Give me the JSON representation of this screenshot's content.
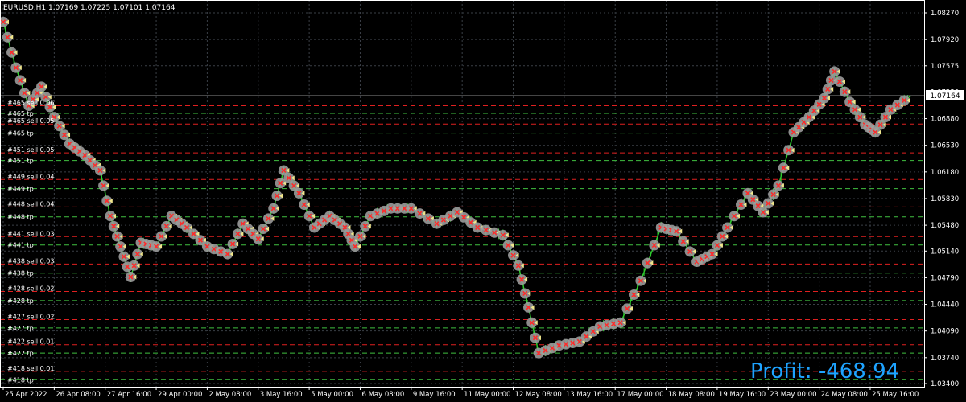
{
  "symbol_header": "EURUSD,H1  1.07169 1.07225 1.07101 1.07164",
  "current_price": "1.07164",
  "profit": {
    "label": "Profit: -468.94",
    "value": -468.94
  },
  "colors": {
    "background": "#000000",
    "grid": "#3a3f46",
    "frame": "#ffffff",
    "candle": "#2ecc2e",
    "sell_line": "#e02020",
    "tp_line": "#40c040",
    "profit_text": "#1ea3ff",
    "marker_circle": "#9a9a9a",
    "marker_cross": "#ff2a2a",
    "marker_arrow": "#f0e68c"
  },
  "chart_data": {
    "type": "line",
    "title": "EURUSD,H1",
    "y_ticks": [
      "1.08270",
      "1.07920",
      "1.07575",
      "1.07230",
      "1.06880",
      "1.06530",
      "1.06180",
      "1.05830",
      "1.05480",
      "1.05140",
      "1.04790",
      "1.04440",
      "1.04090",
      "1.03740",
      "1.03400"
    ],
    "ylim": [
      1.034,
      1.0827
    ],
    "x_ticks": [
      "25 Apr 2022",
      "26 Apr 08:00",
      "27 Apr 16:00",
      "29 Apr 00:00",
      "2 May 08:00",
      "3 May 16:00",
      "5 May 00:00",
      "6 May 08:00",
      "9 May 16:00",
      "11 May 00:00",
      "12 May 08:00",
      "13 May 16:00",
      "17 May 00:00",
      "18 May 08:00",
      "19 May 16:00",
      "23 May 00:00",
      "24 May 08:00",
      "25 May 16:00"
    ],
    "x_tick_index": [
      0,
      1,
      2,
      3,
      4,
      5,
      6,
      7,
      8,
      9,
      10,
      11,
      12,
      13,
      14,
      15,
      16,
      17
    ],
    "price_series": [
      {
        "t": 0.0,
        "p": 1.0815
      },
      {
        "t": 0.25,
        "p": 1.0755
      },
      {
        "t": 0.5,
        "p": 1.0705
      },
      {
        "t": 0.75,
        "p": 1.073
      },
      {
        "t": 1.0,
        "p": 1.069
      },
      {
        "t": 1.3,
        "p": 1.0655
      },
      {
        "t": 1.6,
        "p": 1.064
      },
      {
        "t": 1.9,
        "p": 1.062
      },
      {
        "t": 2.1,
        "p": 1.056
      },
      {
        "t": 2.3,
        "p": 1.052
      },
      {
        "t": 2.5,
        "p": 1.048
      },
      {
        "t": 2.7,
        "p": 1.0525
      },
      {
        "t": 3.0,
        "p": 1.052
      },
      {
        "t": 3.3,
        "p": 1.056
      },
      {
        "t": 3.6,
        "p": 1.0545
      },
      {
        "t": 4.0,
        "p": 1.052
      },
      {
        "t": 4.4,
        "p": 1.051
      },
      {
        "t": 4.7,
        "p": 1.055
      },
      {
        "t": 5.0,
        "p": 1.053
      },
      {
        "t": 5.3,
        "p": 1.057
      },
      {
        "t": 5.5,
        "p": 1.062
      },
      {
        "t": 5.8,
        "p": 1.059
      },
      {
        "t": 6.1,
        "p": 1.0545
      },
      {
        "t": 6.4,
        "p": 1.056
      },
      {
        "t": 6.7,
        "p": 1.0545
      },
      {
        "t": 6.9,
        "p": 1.052
      },
      {
        "t": 7.2,
        "p": 1.056
      },
      {
        "t": 7.6,
        "p": 1.057
      },
      {
        "t": 8.0,
        "p": 1.057
      },
      {
        "t": 8.5,
        "p": 1.055
      },
      {
        "t": 8.9,
        "p": 1.0565
      },
      {
        "t": 9.3,
        "p": 1.0545
      },
      {
        "t": 9.8,
        "p": 1.0535
      },
      {
        "t": 10.1,
        "p": 1.0495
      },
      {
        "t": 10.3,
        "p": 1.044
      },
      {
        "t": 10.5,
        "p": 1.038
      },
      {
        "t": 10.9,
        "p": 1.039
      },
      {
        "t": 11.3,
        "p": 1.0395
      },
      {
        "t": 11.7,
        "p": 1.0415
      },
      {
        "t": 12.1,
        "p": 1.042
      },
      {
        "t": 12.5,
        "p": 1.0475
      },
      {
        "t": 12.9,
        "p": 1.0545
      },
      {
        "t": 13.2,
        "p": 1.054
      },
      {
        "t": 13.6,
        "p": 1.05
      },
      {
        "t": 13.9,
        "p": 1.051
      },
      {
        "t": 14.2,
        "p": 1.0545
      },
      {
        "t": 14.6,
        "p": 1.059
      },
      {
        "t": 14.9,
        "p": 1.0565
      },
      {
        "t": 15.2,
        "p": 1.06
      },
      {
        "t": 15.5,
        "p": 1.067
      },
      {
        "t": 15.8,
        "p": 1.069
      },
      {
        "t": 16.1,
        "p": 1.0715
      },
      {
        "t": 16.3,
        "p": 1.075
      },
      {
        "t": 16.6,
        "p": 1.071
      },
      {
        "t": 16.9,
        "p": 1.068
      },
      {
        "t": 17.1,
        "p": 1.067
      },
      {
        "t": 17.4,
        "p": 1.07
      },
      {
        "t": 17.8,
        "p": 1.0718
      }
    ],
    "orders": [
      {
        "label": "#465 sell 0.06",
        "price": 1.0705,
        "tp_label": "#465 tp",
        "tp_price": 1.0695
      },
      {
        "label": "#465 sell 0.05",
        "price": 1.0681,
        "tp_label": "#465 tp",
        "tp_price": 1.0669
      },
      {
        "label": "#451 sell 0.05",
        "price": 1.0643,
        "tp_label": "#451 tp",
        "tp_price": 1.0633
      },
      {
        "label": "#449 sell 0.04",
        "price": 1.0608,
        "tp_label": "#449 tp",
        "tp_price": 1.0596
      },
      {
        "label": "#448 sell 0.04",
        "price": 1.0572,
        "tp_label": "#448 tp",
        "tp_price": 1.0559
      },
      {
        "label": "#441 sell 0.03",
        "price": 1.0533,
        "tp_label": "#441 tp",
        "tp_price": 1.0522
      },
      {
        "label": "#438 sell 0.03",
        "price": 1.0497,
        "tp_label": "#438 tp",
        "tp_price": 1.0485
      },
      {
        "label": "#428 sell 0.02",
        "price": 1.0461,
        "tp_label": "#428 tp",
        "tp_price": 1.0449
      },
      {
        "label": "#427 sell 0.02",
        "price": 1.0424,
        "tp_label": "#427 tp",
        "tp_price": 1.0413
      },
      {
        "label": "#422 sell 0.01",
        "price": 1.0391,
        "tp_label": "#422 tp",
        "tp_price": 1.038
      },
      {
        "label": "#418 sell 0.01",
        "price": 1.0356,
        "tp_label": "#418 tp",
        "tp_price": 1.0345
      }
    ],
    "grid": true,
    "legend": "none"
  }
}
